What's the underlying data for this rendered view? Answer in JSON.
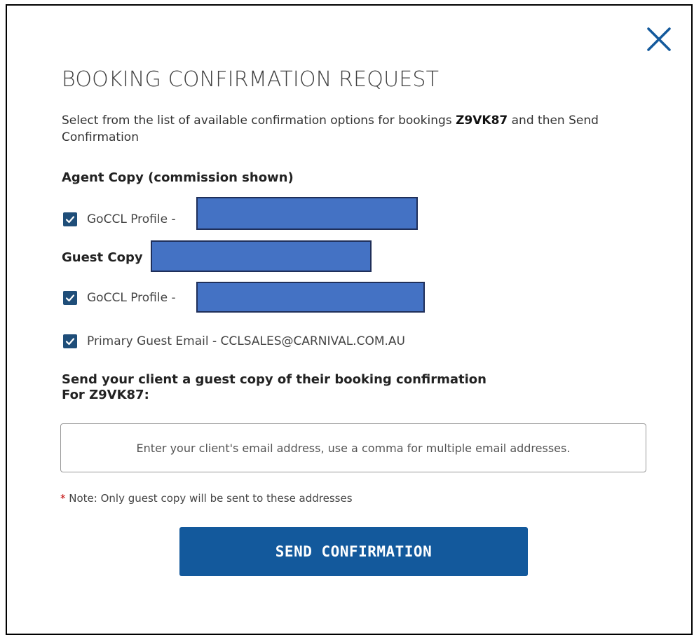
{
  "dialog": {
    "title": "BOOKING CONFIRMATION REQUEST",
    "intro_prefix": "Select from the list of available confirmation options for bookings",
    "booking_code": "Z9VK87",
    "intro_suffix": "and then Send Confirmation"
  },
  "agent_copy": {
    "label": "Agent Copy (commission shown)",
    "options": [
      {
        "label": "GoCCL Profile -",
        "checked": true
      }
    ]
  },
  "guest_copy": {
    "label": "Guest Copy",
    "options": [
      {
        "label": "GoCCL Profile -",
        "checked": true
      },
      {
        "label": "Primary Guest Email - CCLSALES@CARNIVAL.COM.AU",
        "checked": true
      }
    ]
  },
  "send_section": {
    "line1": "Send your client a guest copy of their booking confirmation",
    "line2": "For Z9VK87:"
  },
  "email_input": {
    "placeholder": "Enter your client's email address, use a comma for multiple email addresses.",
    "value": ""
  },
  "note": {
    "star": "*",
    "text": "Note: Only guest copy will be sent to these addresses"
  },
  "send_button": {
    "label": "SEND CONFIRMATION"
  },
  "colors": {
    "accent": "#13599c",
    "checkbox": "#1f4e79",
    "redaction": "#4472c4",
    "required_star": "#c00000"
  },
  "icons": {
    "close": "close-icon",
    "check": "checkmark-icon"
  }
}
